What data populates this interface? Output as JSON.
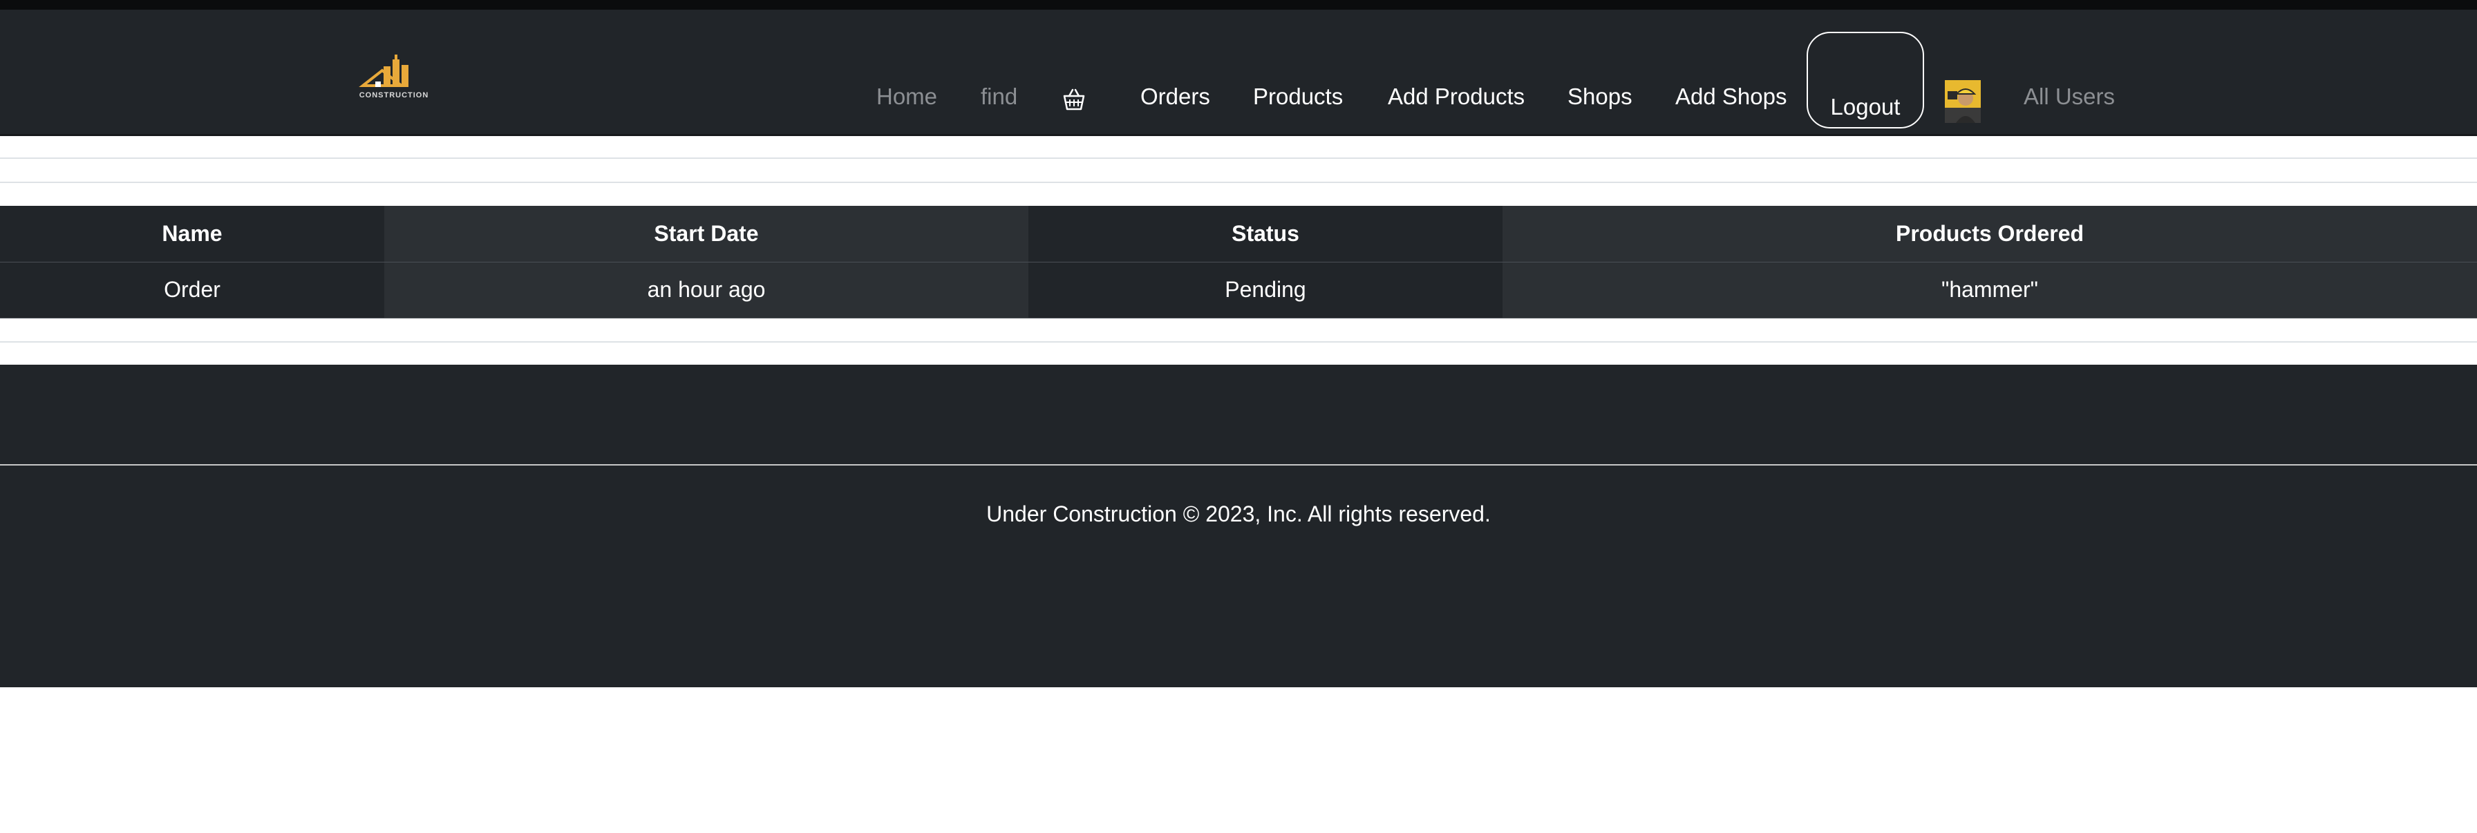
{
  "navbar": {
    "brand_text": "CONSTRUCTION",
    "links": {
      "home": "Home",
      "find": "find",
      "orders": "Orders",
      "products": "Products",
      "add_products": "Add Products",
      "shops": "Shops",
      "add_shops": "Add Shops",
      "logout": "Logout",
      "all_users": "All Users"
    },
    "icons": {
      "logo": "construction-logo-icon",
      "cart": "basket-icon",
      "avatar": "user-avatar-icon"
    }
  },
  "orders_table": {
    "headers": [
      "Name",
      "Start Date",
      "Status",
      "Products Ordered"
    ],
    "rows": [
      [
        "Order",
        "an hour ago",
        "Pending",
        "\"hammer\""
      ]
    ]
  },
  "footer": {
    "text": "Under Construction © 2023, Inc. All rights reserved."
  },
  "colors": {
    "navbar_bg": "#212529",
    "table_dark": "#212529",
    "table_stripe": "#2c3034",
    "logo_gold": "#e8a93a"
  }
}
